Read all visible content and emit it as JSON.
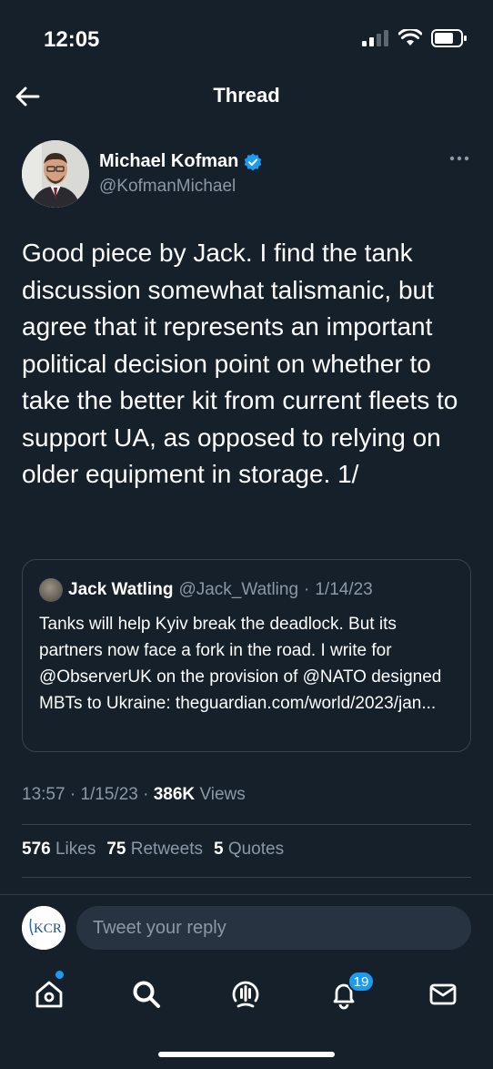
{
  "status_bar": {
    "time": "12:05"
  },
  "header": {
    "title": "Thread"
  },
  "tweet": {
    "author_name": "Michael Kofman",
    "author_handle": "@KofmanMichael",
    "text": "Good piece by Jack. I find the tank discussion somewhat talismanic, but agree that it represents an important political decision point on whether to take the better kit from current fleets to support UA, as opposed to relying on older equipment in storage.  1/",
    "time": "13:57",
    "date": "1/15/23",
    "views_count": "386K",
    "views_label": "Views",
    "likes_count": "576",
    "likes_label": "Likes",
    "retweets_count": "75",
    "retweets_label": "Retweets",
    "quotes_count": "5",
    "quotes_label": "Quotes"
  },
  "quoted_tweet": {
    "author_name": "Jack Watling",
    "author_handle": "@Jack_Watling",
    "date": "1/14/23",
    "text": "Tanks will help Kyiv break the deadlock. But its partners now face a fork in the road. I write for @ObserverUK on the provision of @NATO designed MBTs to Ukraine: theguardian.com/world/2023/jan..."
  },
  "reply": {
    "avatar_text": "KCR",
    "placeholder": "Tweet your reply"
  },
  "tab_bar": {
    "notifications_badge": "19",
    "icons": [
      "home-icon",
      "search-icon",
      "spaces-icon",
      "notifications-icon",
      "messages-icon"
    ]
  },
  "colors": {
    "background": "#15202b",
    "accent": "#1d9bf0",
    "secondary_text": "#8b98a5",
    "divider": "#38444d"
  }
}
